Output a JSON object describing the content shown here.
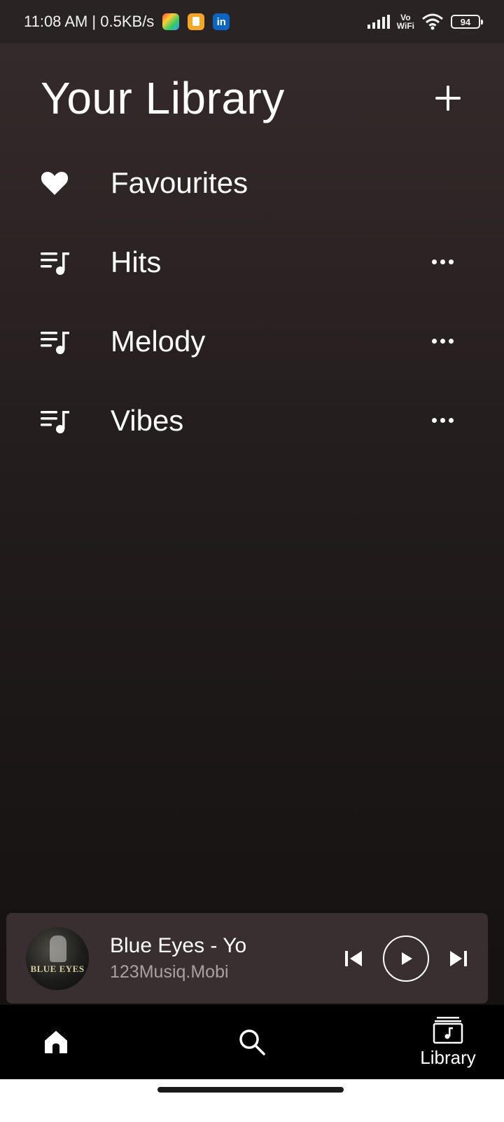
{
  "status_bar": {
    "time": "11:08 AM | 0.5KB/s",
    "network_label_top": "Vo",
    "network_label_bottom": "WiFi",
    "battery": "94"
  },
  "header": {
    "title": "Your Library",
    "add_icon": "plus-icon"
  },
  "library": {
    "items": [
      {
        "label": "Favourites",
        "icon": "heart-icon",
        "has_more": false
      },
      {
        "label": "Hits",
        "icon": "playlist-icon",
        "has_more": true
      },
      {
        "label": "Melody",
        "icon": "playlist-icon",
        "has_more": true
      },
      {
        "label": "Vibes",
        "icon": "playlist-icon",
        "has_more": true
      }
    ]
  },
  "mini_player": {
    "album_art_text": "BLUE EYES",
    "track_title": "Blue Eyes - Yo",
    "track_artist": "123Musiq.Mobi"
  },
  "bottom_nav": {
    "home_icon": "home-icon",
    "search_icon": "search-icon",
    "library_label": "Library"
  },
  "colors": {
    "background_top": "#352a2b",
    "background_bottom": "#151111",
    "mini_player_bg": "#392f30",
    "nav_bg": "#000000",
    "artist_text": "#a9a1a1"
  }
}
